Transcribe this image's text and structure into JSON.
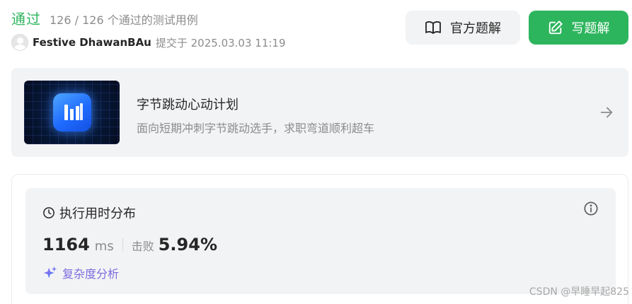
{
  "header": {
    "status": "通过",
    "tests_passed": "126 / 126 个通过的测试用例",
    "username": "Festive DhawanBAu",
    "submitted_at": "提交于 2025.03.03 11:19",
    "official_solution_label": "官方题解",
    "write_solution_label": "写题解"
  },
  "promo": {
    "title": "字节跳动心动计划",
    "subtitle": "面向短期冲刺字节跳动选手，求职弯道顺利超车",
    "image_icon": "bar-chart-logo-icon"
  },
  "runtime": {
    "title": "执行用时分布",
    "value": "1164",
    "unit": "ms",
    "beats_label": "击败",
    "beats_value": "5.94%",
    "complexity_label": "复杂度分析"
  },
  "watermark": "CSDN @早睡早起825",
  "colors": {
    "accent_green": "#2db55d",
    "button_gray": "#f2f3f5",
    "complexity_purple": "#7d6bdf"
  }
}
